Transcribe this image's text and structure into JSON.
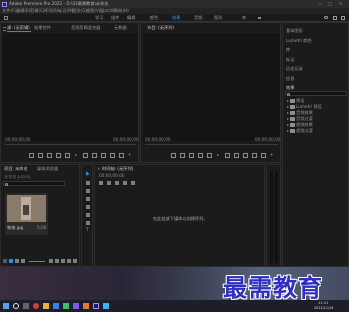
{
  "window": {
    "title": "Adobe Premiere Pro 2022 - D:\\02最需教育\\未命名",
    "controls": {
      "minimize": "—",
      "maximize": "□",
      "close": "✕"
    }
  },
  "menubar": [
    "文件(F)",
    "编辑(E)",
    "剪辑(C)",
    "序列(S)",
    "标记(M)",
    "图形(G)",
    "视图(V)",
    "窗口(W)",
    "帮助(H)"
  ],
  "workspaces": [
    "学习",
    "组件",
    "编辑",
    "颜色",
    "效果",
    "音频",
    "图形",
    "库"
  ],
  "workspace_active": "效果",
  "source_panel": {
    "tabs": [
      "源: (无剪辑)",
      "效果控件",
      "音频剪辑混合器",
      "元数据"
    ],
    "timecode_left": "00;00;00;00",
    "timecode_right": "00;00;00;00"
  },
  "program_panel": {
    "tab": "节目: (无序列)",
    "timecode_left": "00;00;00;00",
    "timecode_right": "00;00;00;00"
  },
  "right_panel": {
    "items": [
      "基本图形",
      "Lumetri 颜色",
      "库",
      "标记",
      "历史记录",
      "信息"
    ],
    "effects_header": "效果",
    "effects_items": [
      "预设",
      "Lumetri 预设",
      "音频效果",
      "音频过渡",
      "视频效果",
      "视频过渡"
    ]
  },
  "project_panel": {
    "tabs": [
      "项目: 未命名",
      "媒体浏览器"
    ],
    "path": "未命名.prproj",
    "clip_name": "装修.jpg",
    "clip_duration": "5;00"
  },
  "timeline_panel": {
    "tab": "时间轴: (无序列)",
    "timecode": "00;00;00;00",
    "empty_message": "在此处放下媒体以创建序列。"
  },
  "taskbar": {
    "time": "11:21",
    "date": "2021/11/24"
  },
  "watermark": "最需教育",
  "colors": {
    "accent": "#2d8ceb",
    "bg": "#1e1e1e",
    "panel": "#1b1b1b",
    "taskbar": "#1c1f2a"
  }
}
